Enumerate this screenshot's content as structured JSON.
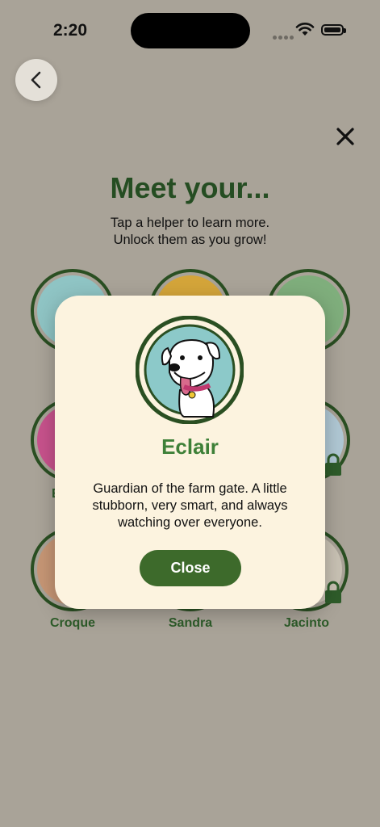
{
  "status": {
    "time": "2:20"
  },
  "header": {
    "title": "Meet your...",
    "subtitle_line1": "Tap a helper to learn more.",
    "subtitle_line2": "Unlock them as you grow!"
  },
  "helpers": [
    {
      "name": "",
      "color": "#8fc4c4",
      "locked": false
    },
    {
      "name": "",
      "color": "#d4a53a",
      "locked": false
    },
    {
      "name": "",
      "color": "#7fae7c",
      "locked": false
    },
    {
      "name": "E",
      "color": "#c7528c",
      "locked": false
    },
    {
      "name": "",
      "color": "#9c9a94",
      "locked": false
    },
    {
      "name": "",
      "color": "#b0c8d4",
      "locked": true
    },
    {
      "name": "Croque",
      "color": "#c69675",
      "locked": false
    },
    {
      "name": "Sandra",
      "color": "#9b9890",
      "locked": false
    },
    {
      "name": "Jacinto",
      "color": "#c9c2b4",
      "locked": true
    }
  ],
  "modal": {
    "name": "Eclair",
    "description": "Guardian of the farm gate. A little stubborn, very smart, and always watching over everyone.",
    "close_label": "Close"
  },
  "colors": {
    "accent": "#3d6a2b",
    "title": "#254d22",
    "card": "#fcf3df",
    "overlay": "#a9a398"
  }
}
